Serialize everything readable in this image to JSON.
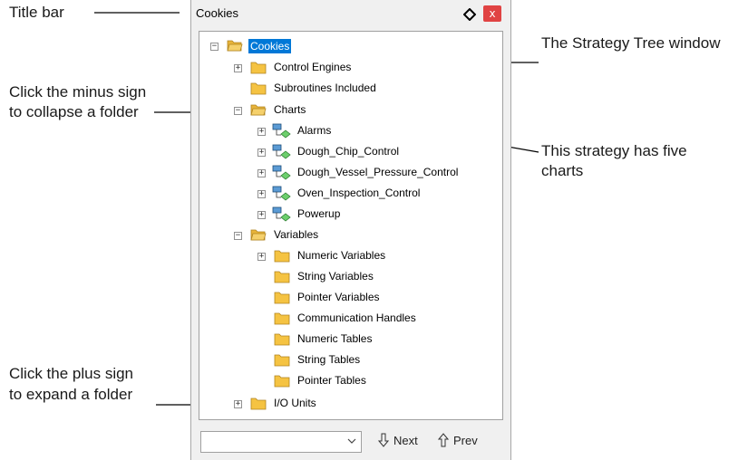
{
  "callouts": {
    "title_bar": "Title bar",
    "collapse_line1": "Click the minus sign",
    "collapse_line2": "to collapse a folder",
    "expand_line1": "Click the plus sign",
    "expand_line2": "to expand a folder",
    "strategy_tree": "The Strategy Tree window",
    "five_charts_line1": "This strategy has five",
    "five_charts_line2": "charts"
  },
  "window": {
    "title": "Cookies",
    "close_label": "x",
    "pin_icon": "pin-icon",
    "close_color": "#e04343"
  },
  "tree": {
    "root": "Cookies",
    "control_engines": "Control Engines",
    "subroutines": "Subroutines Included",
    "charts": "Charts",
    "chart_items": [
      "Alarms",
      "Dough_Chip_Control",
      "Dough_Vessel_Pressure_Control",
      "Oven_Inspection_Control",
      "Powerup"
    ],
    "variables": "Variables",
    "variable_items": [
      "Numeric Variables",
      "String Variables",
      "Pointer Variables",
      "Communication Handles",
      "Numeric Tables",
      "String Tables",
      "Pointer Tables"
    ],
    "io_units": "I/O Units",
    "selected_color": "#0078d7",
    "folder_color": "#f5c342"
  },
  "navigation": {
    "dropdown_value": "",
    "next_label": "Next",
    "prev_label": "Prev"
  }
}
